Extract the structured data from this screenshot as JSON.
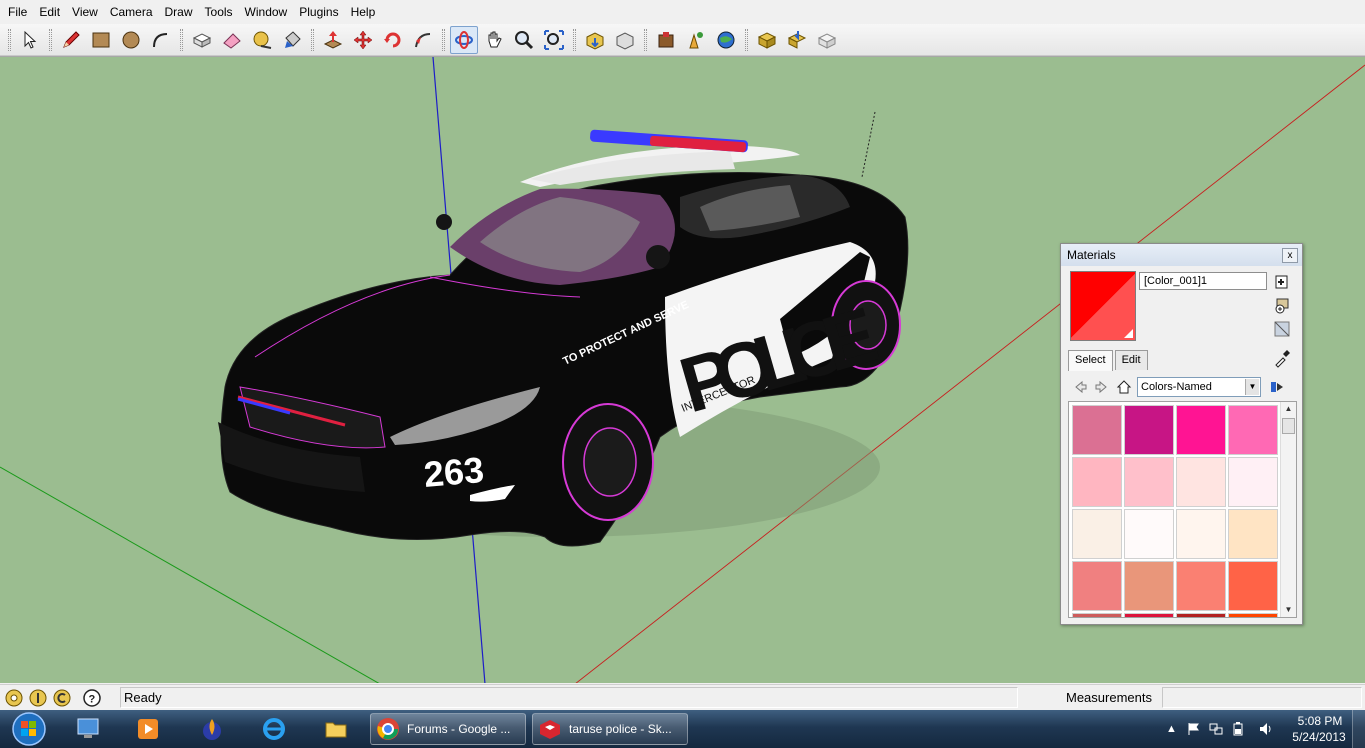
{
  "menu": [
    "File",
    "Edit",
    "View",
    "Camera",
    "Draw",
    "Tools",
    "Window",
    "Plugins",
    "Help"
  ],
  "toolbar": {
    "tools": [
      "select-icon",
      "pencil-icon",
      "rectangle-icon",
      "circle-icon",
      "arc-icon",
      "make-component-icon",
      "eraser-icon",
      "tape-measure-icon",
      "paint-bucket-icon",
      "push-pull-icon",
      "move-icon",
      "rotate-icon",
      "follow-me-icon",
      "orbit-icon",
      "pan-icon",
      "zoom-icon",
      "zoom-extents-icon",
      "3d-warehouse-get-models-icon",
      "share-model-icon",
      "share-component-icon",
      "google-earth-toggle-icon",
      "google-earth-snapshot-icon",
      "get-current-view-icon",
      "extension-warehouse-icon",
      "photo-textures-icon",
      "add-location-icon"
    ]
  },
  "viewport": {
    "background": "#9bbd90",
    "car": {
      "bumper_number": "263",
      "door_text": "POLICE",
      "fender_text": "TO PROTECT AND SERVE",
      "sub_text": "INTERCEPTOR"
    }
  },
  "materials": {
    "title": "Materials",
    "close": "x",
    "material_name": "[Color_001]1",
    "tabs": [
      "Select",
      "Edit"
    ],
    "collection": "Colors-Named",
    "swatches": [
      "#db7093",
      "#c71585",
      "#ff1493",
      "#ff69b4",
      "#ffb6c1",
      "#ffc0cb",
      "#ffe4e1",
      "#fff0f5",
      "#faf0e6",
      "#fffafa",
      "#fff5ee",
      "#ffe4c4",
      "#f08080",
      "#e9967a",
      "#fa8072",
      "#ff6347",
      "#cd5c5c",
      "#dc143c",
      "#b22222",
      "#ff4500"
    ]
  },
  "statusbar": {
    "status": "Ready",
    "measurements_label": "Measurements",
    "measurements_value": ""
  },
  "taskbar": {
    "tasks": [
      {
        "label": "Forums - Google ..."
      },
      {
        "label": "taruse police - Sk..."
      }
    ],
    "clock_time": "5:08 PM",
    "clock_date": "5/24/2013"
  }
}
